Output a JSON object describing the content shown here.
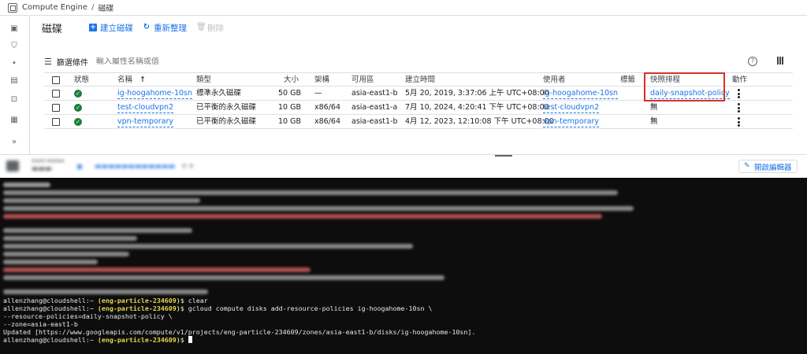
{
  "topbar": {
    "product": "Compute Engine",
    "separator": "/",
    "page": "磁碟"
  },
  "header": {
    "title": "磁碟",
    "create_label": "建立磁碟",
    "refresh_label": "重新整理",
    "delete_label": "刪除"
  },
  "filter": {
    "label": "篩選條件",
    "placeholder": "輸入屬性名稱或值"
  },
  "table": {
    "columns": {
      "status": "狀態",
      "name": "名稱",
      "type": "類型",
      "size": "大小",
      "arch": "架構",
      "zone": "可用區",
      "created": "建立時間",
      "in_use_by": "使用者",
      "labels": "標籤",
      "snapshot_schedule": "快照排程",
      "actions": "動作"
    },
    "rows": [
      {
        "name": "ig-hoogahome-10sn",
        "type": "標準永久磁碟",
        "size": "50 GB",
        "arch": "—",
        "zone": "asia-east1-b",
        "created": "5月 20, 2019, 3:37:06 上午 UTC+08:00",
        "in_use_by": "ig-hoogahome-10sn",
        "labels": "",
        "snapshot_schedule": "daily-snapshot-policy"
      },
      {
        "name": "test-cloudvpn2",
        "type": "已平衡的永久磁碟",
        "size": "10 GB",
        "arch": "x86/64",
        "zone": "asia-east1-a",
        "created": "7月 10, 2024, 4:20:41 下午 UTC+08:00",
        "in_use_by": "test-cloudvpn2",
        "labels": "",
        "snapshot_schedule": "無"
      },
      {
        "name": "vpn-temporary",
        "type": "已平衡的永久磁碟",
        "size": "10 GB",
        "arch": "x86/64",
        "zone": "asia-east1-b",
        "created": "4月 12, 2023, 12:10:08 下午 UTC+08:00",
        "in_use_by": "vpn-temporary",
        "labels": "",
        "snapshot_schedule": "無"
      }
    ]
  },
  "shell": {
    "open_editor_label": "開啟編輯器"
  },
  "terminal": {
    "prompt_user": "allenzhang@cloudshell:~",
    "prompt_project": "(eng-particle-234609)",
    "lines": [
      {
        "cmd": "clear"
      },
      {
        "cmd": "gcloud compute disks add-resource-policies ig-hoogahome-10sn \\"
      },
      {
        "text": "--resource-policies=daily-snapshot-policy \\"
      },
      {
        "text": "--zone=asia-east1-b"
      },
      {
        "text": "Updated [https://www.googleapis.com/compute/v1/projects/eng-particle-234609/zones/asia-east1-b/disks/ig-hoogahome-10sn]."
      },
      {
        "cmd": ""
      }
    ]
  },
  "colors": {
    "accent": "#1a73e8",
    "ok": "#188038",
    "highlight": "#d93025",
    "terminal_bg": "#0d0d0d",
    "prompt_project": "#e8d44d"
  }
}
